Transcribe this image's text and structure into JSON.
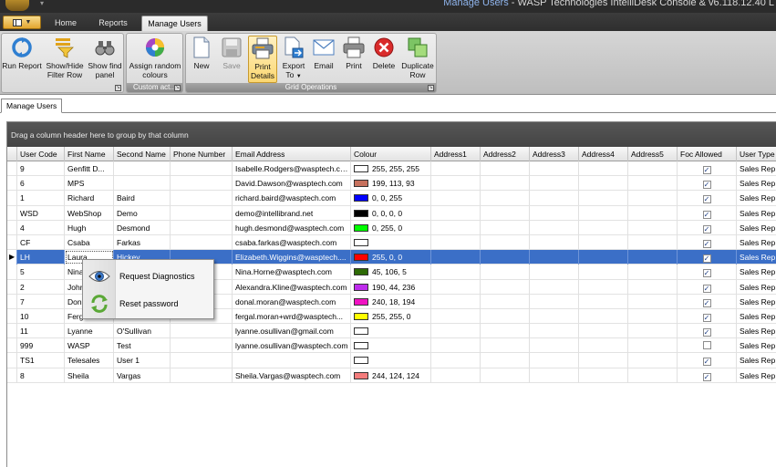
{
  "window": {
    "title_highlight": "Manage Users",
    "title_rest": " - WASP Technologies IntelliDesk Console & v6.118.12.40 L"
  },
  "ribbon_tabs": [
    {
      "label": "Home",
      "active": false
    },
    {
      "label": "Reports",
      "active": false
    },
    {
      "label": "Manage Users",
      "active": true
    }
  ],
  "ribbon_groups": {
    "group1": {
      "buttons": [
        {
          "line1": "Run Report",
          "line2": ""
        },
        {
          "line1": "Show/Hide",
          "line2": "Filter Row"
        },
        {
          "line1": "Show find",
          "line2": "panel"
        }
      ]
    },
    "group2": {
      "label": "Custom act...",
      "buttons": [
        {
          "line1": "Assign random",
          "line2": "colours"
        }
      ]
    },
    "group3": {
      "label": "Grid Operations",
      "buttons": [
        {
          "line1": "New",
          "line2": ""
        },
        {
          "line1": "Save",
          "line2": ""
        },
        {
          "line1": "Print",
          "line2": "Details"
        },
        {
          "line1": "Export",
          "line2": "To"
        },
        {
          "line1": "Email",
          "line2": ""
        },
        {
          "line1": "Print",
          "line2": ""
        },
        {
          "line1": "Delete",
          "line2": ""
        },
        {
          "line1": "Duplicate",
          "line2": "Row"
        }
      ]
    }
  },
  "document_tab": "Manage Users",
  "grid": {
    "group_panel_text": "Drag a column header here to group by that column",
    "columns": [
      "User Code",
      "First Name",
      "Second Name",
      "Phone Number",
      "Email Address",
      "Colour",
      "Address1",
      "Address2",
      "Address3",
      "Address4",
      "Address5",
      "Foc Allowed",
      "User Type"
    ],
    "rows": [
      {
        "code": "9",
        "first": "Genfitt D...",
        "second": "",
        "phone": "",
        "email": "Isabelle.Rodgers@wasptech.com",
        "colour_hex": "#ffffff",
        "colour_text": "255, 255, 255",
        "foc": true,
        "type": "Sales Rep",
        "selected": false
      },
      {
        "code": "6",
        "first": "MPS",
        "second": "",
        "phone": "",
        "email": "David.Dawson@wasptech.com",
        "colour_hex": "#c7715d",
        "colour_text": "199, 113, 93",
        "foc": true,
        "type": "Sales Rep",
        "selected": false
      },
      {
        "code": "1",
        "first": "Richard",
        "second": "Baird",
        "phone": "",
        "email": "richard.baird@wasptech.com",
        "colour_hex": "#0000ff",
        "colour_text": "0, 0, 255",
        "foc": true,
        "type": "Sales Rep",
        "selected": false
      },
      {
        "code": "WSD",
        "first": "WebShop",
        "second": "Demo",
        "phone": "",
        "email": "demo@intellibrand.net",
        "colour_hex": "#000000",
        "colour_text": "0, 0, 0, 0",
        "foc": true,
        "type": "Sales Rep",
        "selected": false
      },
      {
        "code": "4",
        "first": "Hugh",
        "second": "Desmond",
        "phone": "",
        "email": "hugh.desmond@wasptech.com",
        "colour_hex": "#00ff00",
        "colour_text": "0, 255, 0",
        "foc": true,
        "type": "Sales Rep",
        "selected": false
      },
      {
        "code": "CF",
        "first": "Csaba",
        "second": "Farkas",
        "phone": "",
        "email": "csaba.farkas@wasptech.com",
        "colour_hex": "#ffffff",
        "colour_text": "",
        "foc": true,
        "type": "Sales Rep",
        "selected": false
      },
      {
        "code": "LH",
        "first": "Laura",
        "second": "Hickey",
        "phone": "",
        "email": "Elizabeth.Wiggins@wasptech....",
        "colour_hex": "#ff0000",
        "colour_text": "255, 0, 0",
        "foc": true,
        "type": "Sales Rep",
        "selected": true
      },
      {
        "code": "5",
        "first": "Nina",
        "second": "",
        "phone": "",
        "email": "Nina.Horne@wasptech.com",
        "colour_hex": "#2d6a05",
        "colour_text": "45, 106, 5",
        "foc": true,
        "type": "Sales Rep",
        "selected": false
      },
      {
        "code": "2",
        "first": "John",
        "second": "",
        "phone": "",
        "email": "Alexandra.Kline@wasptech.com",
        "colour_hex": "#be2cec",
        "colour_text": "190, 44, 236",
        "foc": true,
        "type": "Sales Rep",
        "selected": false
      },
      {
        "code": "7",
        "first": "Dona",
        "second": "",
        "phone": "",
        "email": "donal.moran@wasptech.com",
        "colour_hex": "#f012c2",
        "colour_text": "240, 18, 194",
        "foc": true,
        "type": "Sales Rep",
        "selected": false
      },
      {
        "code": "10",
        "first": "Ferga",
        "second": "Moran",
        "phone": "",
        "email": "fergal.moran+wrd@wasptech...",
        "colour_hex": "#ffff00",
        "colour_text": "255, 255, 0",
        "foc": true,
        "type": "Sales Rep",
        "selected": false
      },
      {
        "code": "11",
        "first": "Lyanne",
        "second": "O'Sullivan",
        "phone": "",
        "email": "lyanne.osullivan@gmail.com",
        "colour_hex": "#ffffff",
        "colour_text": "",
        "foc": true,
        "type": "Sales Rep",
        "selected": false
      },
      {
        "code": "999",
        "first": "WASP",
        "second": "Test",
        "phone": "",
        "email": "lyanne.osullivan@wasptech.com",
        "colour_hex": "#ffffff",
        "colour_text": "",
        "foc": false,
        "type": "Sales Rep",
        "selected": false
      },
      {
        "code": "TS1",
        "first": "Telesales",
        "second": "User 1",
        "phone": "",
        "email": "",
        "colour_hex": "#ffffff",
        "colour_text": "",
        "foc": true,
        "type": "Sales Rep",
        "selected": false
      },
      {
        "code": "8",
        "first": "Sheila",
        "second": "Vargas",
        "phone": "",
        "email": "Sheila.Vargas@wasptech.com",
        "colour_hex": "#f47c7c",
        "colour_text": "244, 124, 124",
        "foc": true,
        "type": "Sales Rep",
        "selected": false
      }
    ]
  },
  "context_menu": {
    "items": [
      {
        "label": "Request Diagnostics",
        "icon": "eye-icon"
      },
      {
        "label": "Reset password",
        "icon": "refresh-arrows-icon"
      }
    ]
  }
}
